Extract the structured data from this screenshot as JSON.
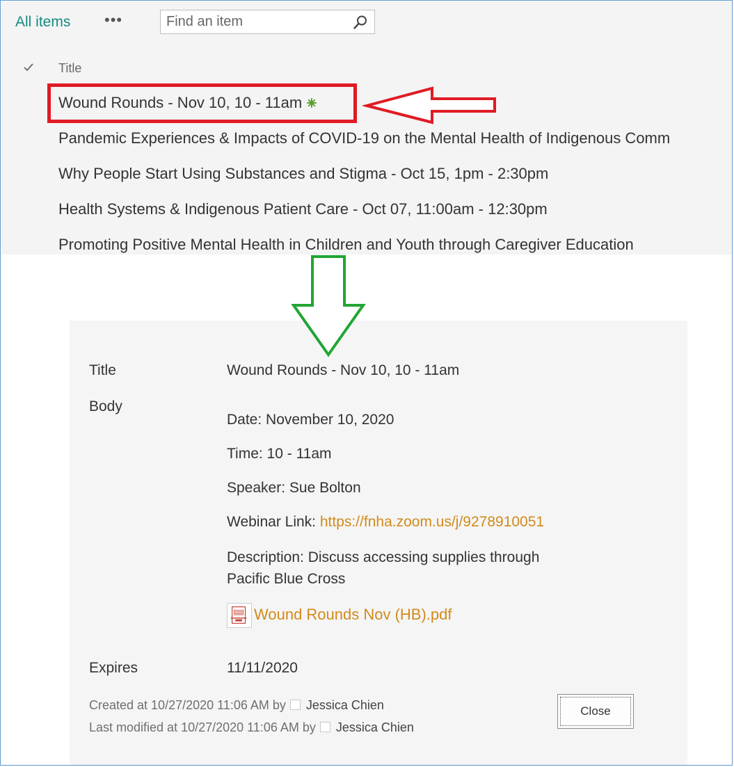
{
  "list": {
    "view_name": "All items",
    "more_label": "•••",
    "search": {
      "placeholder": "Find an item",
      "value": ""
    },
    "column_header": "Title",
    "rows": [
      {
        "title": "Wound Rounds - Nov 10, 10 - 11am",
        "is_new": true
      },
      {
        "title": "Pandemic Experiences & Impacts of COVID-19 on the Mental Health of Indigenous Comm"
      },
      {
        "title": "Why People Start Using Substances and Stigma - Oct 15, 1pm - 2:30pm"
      },
      {
        "title": "Health Systems & Indigenous Patient Care - Oct 07, 11:00am - 12:30pm"
      },
      {
        "title": "Promoting Positive Mental Health in Children and Youth through Caregiver Education"
      }
    ]
  },
  "annotations": {
    "highlight_color": "#e01b24",
    "arrow_down_color": "#22a533"
  },
  "item": {
    "title_label": "Title",
    "title_value": "Wound Rounds - Nov 10, 10 - 11am",
    "body_label": "Body",
    "body": {
      "date": "Date: November 10, 2020",
      "time": "Time: 10 - 11am",
      "speaker": "Speaker: Sue Bolton",
      "webinar_label": "Webinar Link: ",
      "webinar_url": "https://fnha.zoom.us/j/9278910051",
      "description_line1": "Description: Discuss accessing supplies through",
      "description_line2": "Pacific Blue Cross",
      "attachment": "Wound Rounds Nov (HB).pdf"
    },
    "expires_label": "Expires",
    "expires_value": "11/11/2020",
    "created": {
      "prefix": "Created at 10/27/2020 11:06 AM  by",
      "user": "Jessica Chien"
    },
    "modified": {
      "prefix": "Last modified at 10/27/2020 11:06 AM  by",
      "user": "Jessica Chien"
    },
    "close_label": "Close"
  },
  "colors": {
    "accent": "#15897f",
    "link": "#d28a1a",
    "frame": "#5b9bd5"
  },
  "icons": [
    "checkmark-icon",
    "search-icon",
    "new-item-icon",
    "pdf-file-icon",
    "presence-icon"
  ]
}
